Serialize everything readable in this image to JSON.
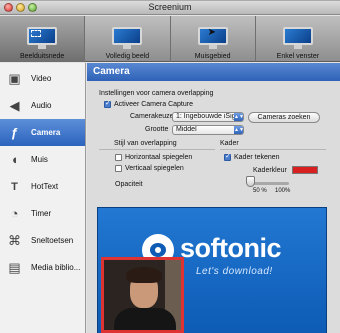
{
  "window": {
    "title": "Screenium"
  },
  "toolbar": {
    "items": [
      {
        "label": "Beelduitsnede",
        "icon": "monitor-crop-icon",
        "active": true
      },
      {
        "label": "Volledig beeld",
        "icon": "monitor-full-icon",
        "active": false
      },
      {
        "label": "Muisgebied",
        "icon": "monitor-mouse-icon",
        "active": false
      },
      {
        "label": "Enkel venster",
        "icon": "monitor-window-icon",
        "active": false
      }
    ]
  },
  "sidebar": {
    "items": [
      {
        "label": "Video",
        "icon": "film-icon"
      },
      {
        "label": "Audio",
        "icon": "speaker-icon"
      },
      {
        "label": "Camera",
        "icon": "camera-icon",
        "active": true
      },
      {
        "label": "Muis",
        "icon": "mouse-icon"
      },
      {
        "label": "HotText",
        "icon": "text-icon"
      },
      {
        "label": "Timer",
        "icon": "stopwatch-icon"
      },
      {
        "label": "Sneltoetsen",
        "icon": "command-key-icon"
      },
      {
        "label": "Media biblio...",
        "icon": "media-library-icon"
      }
    ]
  },
  "main": {
    "title": "Camera",
    "section_overlay": "Instellingen voor camera overlapping",
    "enable_capture": {
      "label": "Activeer Camera Capture",
      "checked": true
    },
    "camera_choice": {
      "label": "Camerakeuze",
      "value": "1: Ingebouwde iSight"
    },
    "search_button": "Cameras zoeken",
    "size": {
      "label": "Grootte",
      "value": "Middel"
    },
    "style_section": "Stijl van overlapping",
    "frame_section": "Kader",
    "flip_horizontal": {
      "label": "Horizontaal spiegelen",
      "checked": false
    },
    "flip_vertical": {
      "label": "Verticaal spiegelen",
      "checked": false
    },
    "frame_draw": {
      "label": "Kader tekenen",
      "checked": true
    },
    "frame_color": {
      "label": "Kaderkleur",
      "color": "#d82020"
    },
    "opacity": {
      "label": "Opaciteit",
      "min_label": "50 %",
      "max_label": "100%",
      "value_fraction": 0.0
    },
    "preview": {
      "brand": "softonic",
      "slogan": "Let's download!"
    }
  },
  "colors": {
    "accent": "#2f62b7",
    "frame": "#d82020",
    "preview_bg": "#1466c4"
  }
}
